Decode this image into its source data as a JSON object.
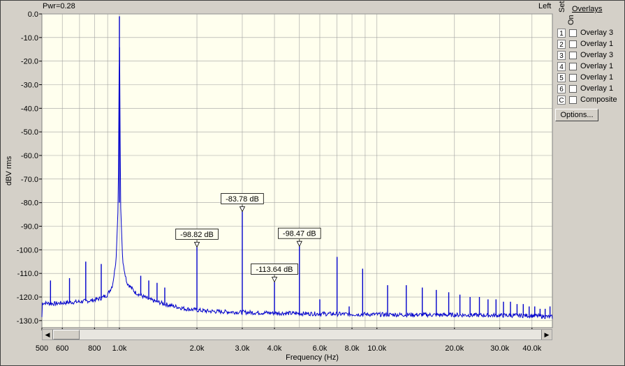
{
  "header": {
    "power_label": "Pwr=0.28",
    "channel_label": "Left"
  },
  "overlays": {
    "title": "Overlays",
    "set_label": "Set",
    "on_label": "On",
    "items": [
      {
        "num": "1",
        "label": "Overlay 3",
        "checked": false
      },
      {
        "num": "2",
        "label": "Overlay 1",
        "checked": false
      },
      {
        "num": "3",
        "label": "Overlay 3",
        "checked": false
      },
      {
        "num": "4",
        "label": "Overlay 1",
        "checked": false
      },
      {
        "num": "5",
        "label": "Overlay 1",
        "checked": false
      },
      {
        "num": "6",
        "label": "Overlay 1",
        "checked": false
      },
      {
        "num": "C",
        "label": "Composite",
        "checked": false
      }
    ],
    "options_label": "Options..."
  },
  "chart_data": {
    "type": "line",
    "xlabel": "Frequency (Hz)",
    "ylabel": "dBV rms",
    "xscale": "log",
    "xlim": [
      500,
      48000
    ],
    "ylim": [
      -133,
      0
    ],
    "grid": true,
    "x_ticks": [
      {
        "value": 500,
        "label": "500"
      },
      {
        "value": 600,
        "label": "600"
      },
      {
        "value": 800,
        "label": "800"
      },
      {
        "value": 1000,
        "label": "1.0k"
      },
      {
        "value": 2000,
        "label": "2.0k"
      },
      {
        "value": 3000,
        "label": "3.0k"
      },
      {
        "value": 4000,
        "label": "4.0k"
      },
      {
        "value": 6000,
        "label": "6.0k"
      },
      {
        "value": 8000,
        "label": "8.0k"
      },
      {
        "value": 10000,
        "label": "10.0k"
      },
      {
        "value": 20000,
        "label": "20.0k"
      },
      {
        "value": 30000,
        "label": "30.0k"
      },
      {
        "value": 40000,
        "label": "40.0k"
      }
    ],
    "y_ticks": [
      {
        "value": 0,
        "label": "0.0"
      },
      {
        "value": -10,
        "label": "-10.0"
      },
      {
        "value": -20,
        "label": "-20.0"
      },
      {
        "value": -30,
        "label": "-30.0"
      },
      {
        "value": -40,
        "label": "-40.0"
      },
      {
        "value": -50,
        "label": "-50.0"
      },
      {
        "value": -60,
        "label": "-60.0"
      },
      {
        "value": -70,
        "label": "-70.0"
      },
      {
        "value": -80,
        "label": "-80.0"
      },
      {
        "value": -90,
        "label": "-90.0"
      },
      {
        "value": -100,
        "label": "-100.0"
      },
      {
        "value": -110,
        "label": "-110.0"
      },
      {
        "value": -120,
        "label": "-120.0"
      },
      {
        "value": -130,
        "label": "-130.0"
      }
    ],
    "series": [
      {
        "color": "#0000cc",
        "noise_floor": [
          [
            500,
            -122.5
          ],
          [
            560,
            -122.8
          ],
          [
            620,
            -122.4
          ],
          [
            700,
            -122.0
          ],
          [
            780,
            -121.5
          ],
          [
            850,
            -120.5
          ],
          [
            900,
            -119.0
          ],
          [
            940,
            -115.0
          ],
          [
            970,
            -105.0
          ],
          [
            990,
            -80.0
          ],
          [
            1000,
            -1.0
          ],
          [
            1010,
            -80.0
          ],
          [
            1030,
            -105.0
          ],
          [
            1070,
            -114.0
          ],
          [
            1150,
            -118.0
          ],
          [
            1300,
            -121.0
          ],
          [
            1500,
            -123.0
          ],
          [
            1800,
            -125.0
          ],
          [
            2200,
            -126.0
          ],
          [
            3000,
            -126.5
          ],
          [
            5000,
            -127.0
          ],
          [
            8000,
            -127.3
          ],
          [
            12000,
            -127.5
          ],
          [
            20000,
            -127.6
          ],
          [
            30000,
            -127.8
          ],
          [
            40000,
            -127.9
          ],
          [
            48000,
            -128.5
          ]
        ],
        "spikes": [
          [
            540,
            -113
          ],
          [
            640,
            -112
          ],
          [
            740,
            -105
          ],
          [
            850,
            -106
          ],
          [
            1210,
            -111
          ],
          [
            1300,
            -113
          ],
          [
            1400,
            -114
          ],
          [
            1500,
            -116
          ],
          [
            2000,
            -98.82
          ],
          [
            3000,
            -83.78
          ],
          [
            4000,
            -113.64
          ],
          [
            5000,
            -98.47
          ],
          [
            6000,
            -121
          ],
          [
            7000,
            -103
          ],
          [
            7800,
            -124
          ],
          [
            8800,
            -108
          ],
          [
            11000,
            -115
          ],
          [
            13000,
            -115
          ],
          [
            15000,
            -116
          ],
          [
            17000,
            -117
          ],
          [
            19000,
            -118
          ],
          [
            21000,
            -119
          ],
          [
            23000,
            -120
          ],
          [
            25000,
            -120
          ],
          [
            27000,
            -121
          ],
          [
            29000,
            -121
          ],
          [
            31000,
            -122
          ],
          [
            33000,
            -122
          ],
          [
            35000,
            -123
          ],
          [
            37000,
            -123
          ],
          [
            39000,
            -124
          ],
          [
            41000,
            -124
          ],
          [
            43000,
            -125
          ],
          [
            45000,
            -125
          ],
          [
            47000,
            -124
          ]
        ]
      }
    ],
    "markers": [
      {
        "x": 2000,
        "y": -98.82,
        "label": "-98.82 dB"
      },
      {
        "x": 3000,
        "y": -83.78,
        "label": "-83.78 dB"
      },
      {
        "x": 4000,
        "y": -113.64,
        "label": "-113.64 dB"
      },
      {
        "x": 5000,
        "y": -98.47,
        "label": "-98.47 dB"
      }
    ]
  }
}
